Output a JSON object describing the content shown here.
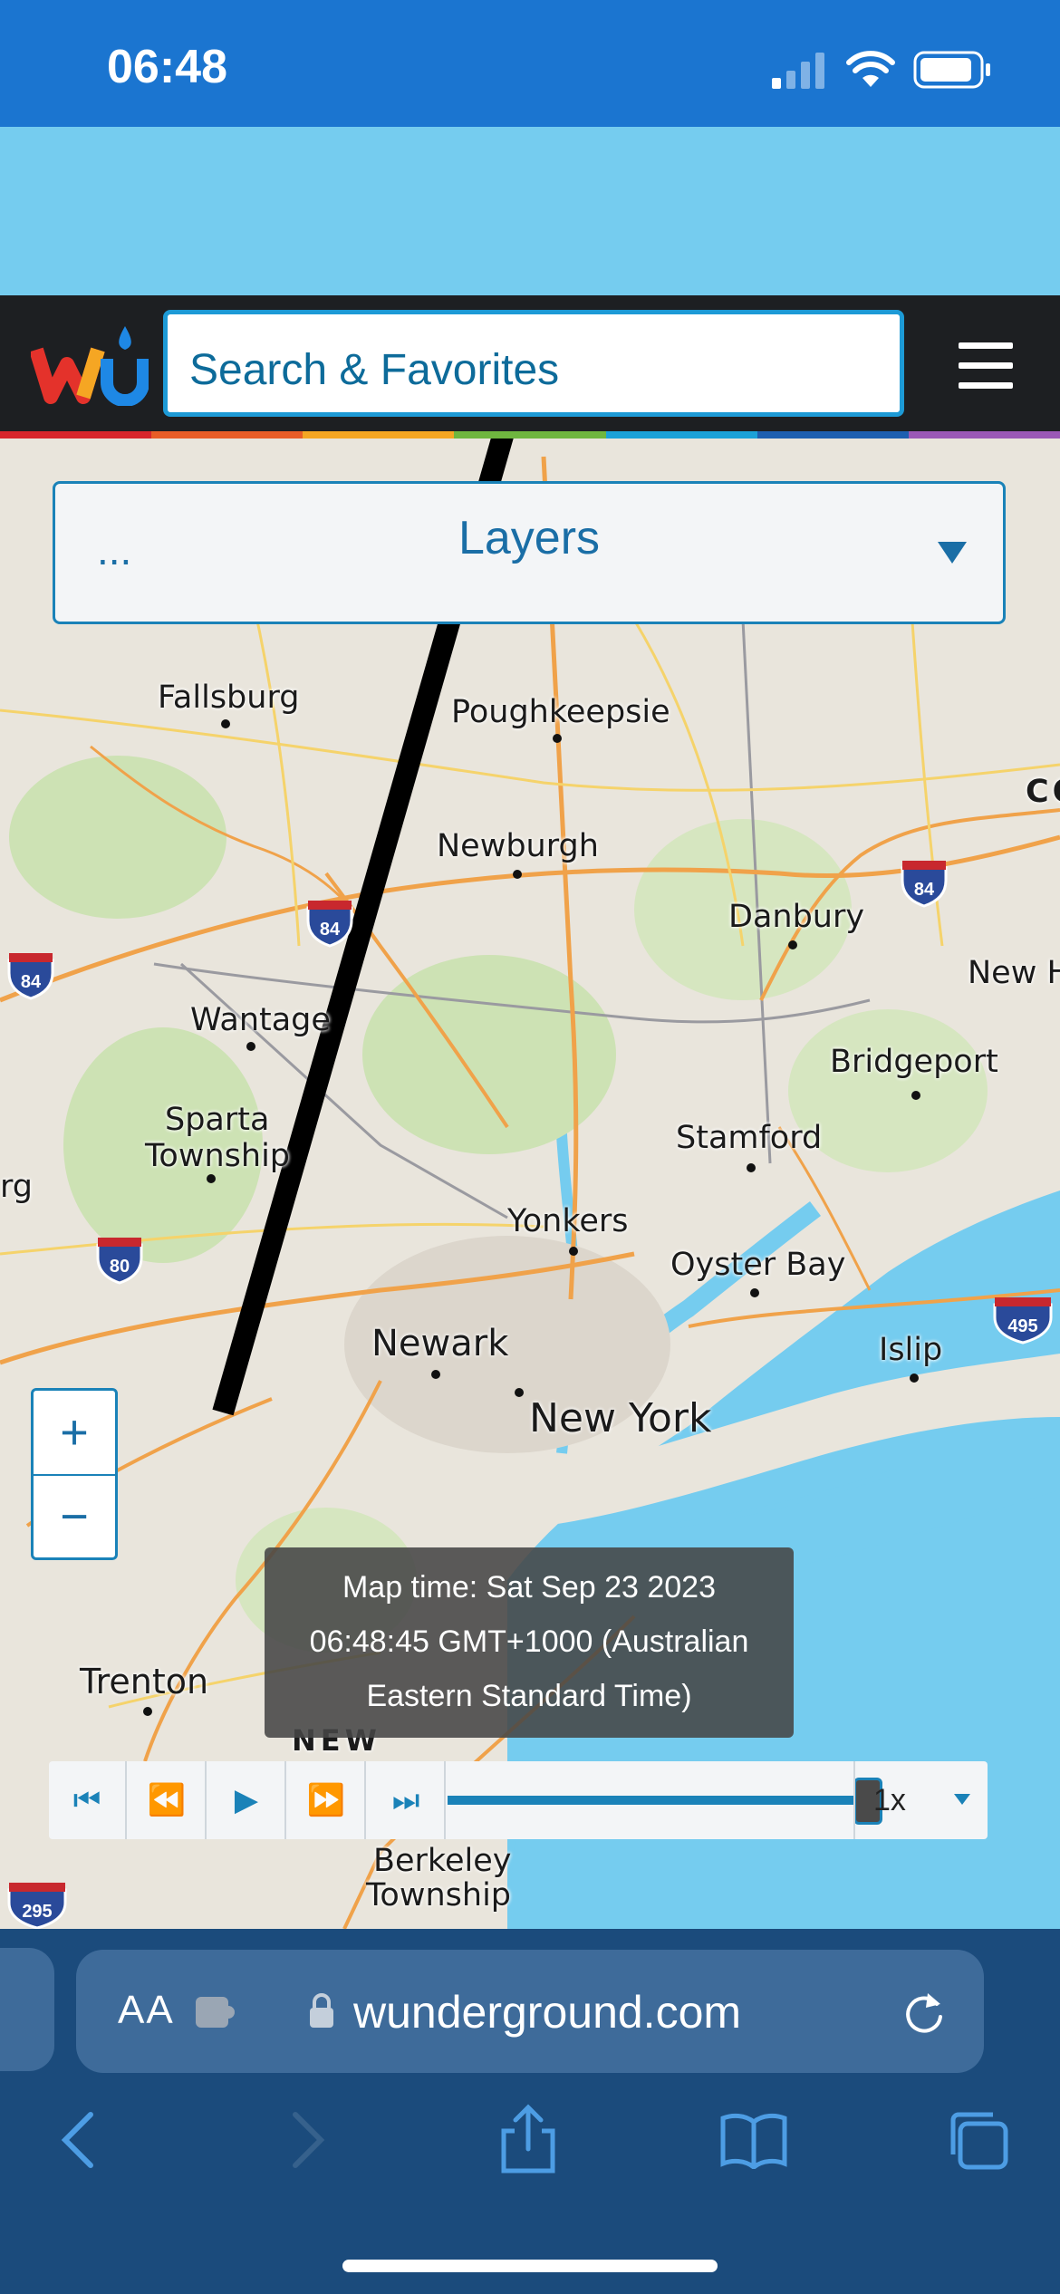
{
  "status_bar": {
    "time": "06:48"
  },
  "header": {
    "logo": "wu",
    "search_placeholder": "Search & Favorites"
  },
  "layers": {
    "more_label": "...",
    "title": "Layers"
  },
  "map": {
    "places": {
      "fallsburg": "Fallsburg",
      "poughkeepsie": "Poughkeepsie",
      "newburgh": "Newburgh",
      "danbury": "Danbury",
      "wantage": "Wantage",
      "new_haven": "New H",
      "bridgeport": "Bridgeport",
      "sparta_1": "Sparta",
      "sparta_2": "Township",
      "stamford": "Stamford",
      "yonkers": "Yonkers",
      "oyster_bay": "Oyster Bay",
      "newark": "Newark",
      "islip": "Islip",
      "new_york": "New York",
      "trenton": "Trenton",
      "new_jersey": "NEW",
      "berkeley_1": "Berkeley",
      "berkeley_2": "Township",
      "connecticut": "CO",
      "edge_left": "rg"
    },
    "shields": {
      "i84_a": "84",
      "i84_b": "84",
      "i84_c": "84",
      "i80": "80",
      "i495": "495",
      "i295": "295"
    }
  },
  "zoom": {
    "in_label": "+",
    "out_label": "−"
  },
  "map_time": {
    "line1": "Map time: Sat Sep 23 2023",
    "line2": "06:48:45 GMT+1000 (Australian",
    "line3": "Eastern Standard Time)"
  },
  "player": {
    "first_icon": "⏮",
    "back_icon": "⏪",
    "play_icon": "▶",
    "forward_icon": "⏩",
    "last_icon": "⏭",
    "speed": "1x",
    "position": 1.0
  },
  "browser": {
    "text_size_label": "AA",
    "url": "wunderground.com"
  }
}
